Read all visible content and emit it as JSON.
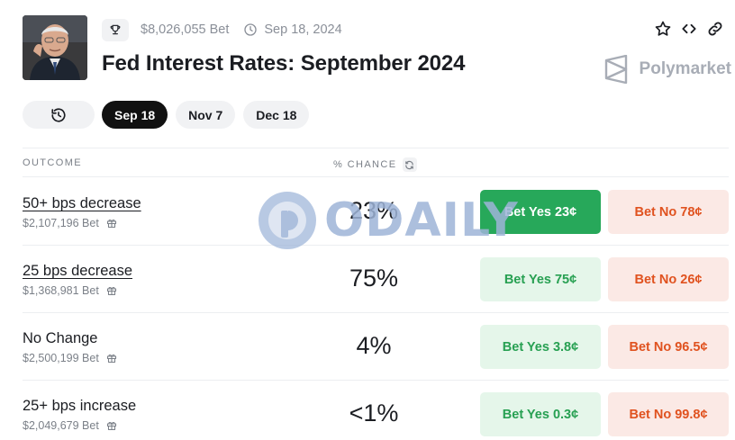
{
  "market": {
    "volume": "$8,026,055 Bet",
    "date": "Sep 18, 2024",
    "title": "Fed Interest Rates: September 2024",
    "brand": "Polymarket",
    "icons": [
      "trophy-icon",
      "clock-icon",
      "star-icon",
      "embed-icon",
      "link-icon"
    ]
  },
  "date_tabs": [
    {
      "label": "Sep 18",
      "active": true
    },
    {
      "label": "Nov 7",
      "active": false
    },
    {
      "label": "Dec 18",
      "active": false
    }
  ],
  "table": {
    "col_outcome": "OUTCOME",
    "col_chance": "% CHANCE",
    "rows": [
      {
        "name": "50+ bps decrease",
        "volume": "$2,107,196 Bet",
        "chance": "23%",
        "yes": "Bet Yes 23¢",
        "no": "Bet No 78¢"
      },
      {
        "name": "25 bps decrease",
        "volume": "$1,368,981 Bet",
        "chance": "75%",
        "yes": "Bet Yes 75¢",
        "no": "Bet No 26¢"
      },
      {
        "name": "No Change",
        "volume": "$2,500,199 Bet",
        "chance": "4%",
        "yes": "Bet Yes 3.8¢",
        "no": "Bet No 96.5¢"
      },
      {
        "name": "25+ bps increase",
        "volume": "$2,049,679 Bet",
        "chance": "<1%",
        "yes": "Bet Yes 0.3¢",
        "no": "Bet No 99.8¢"
      }
    ]
  },
  "watermark": {
    "text": "ODAILY"
  },
  "colors": {
    "yes_solid": "#27a85a",
    "yes_text": "#27a052",
    "yes_bg": "#e5f6ea",
    "no_text": "#e0521f",
    "no_bg": "#fbe9e5",
    "active_tab": "#111111"
  }
}
